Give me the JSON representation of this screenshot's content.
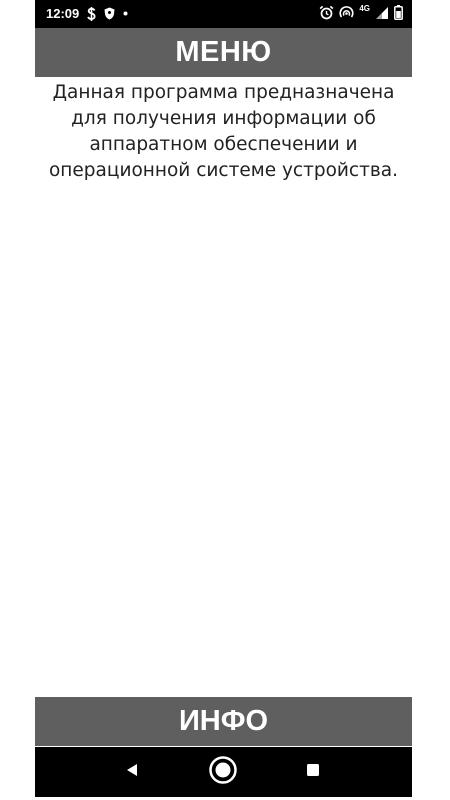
{
  "status_bar": {
    "time": "12:09",
    "icons": [
      "dollar-icon",
      "shield-icon",
      "dot-icon",
      "alarm-icon",
      "hotspot-icon",
      "signal-4g-icon",
      "battery-icon"
    ],
    "network_label": "4G"
  },
  "header": {
    "title": "МЕНЮ"
  },
  "main": {
    "description": "Данная программа предназначена для получения информации об аппаратном обеспечении и операционной системе устройства."
  },
  "footer": {
    "info_button_label": "ИНФО"
  },
  "nav_bar": {
    "buttons": [
      "back-icon",
      "home-icon",
      "recents-icon"
    ]
  },
  "colors": {
    "header_bg": "#5f5f5f",
    "status_bar_bg": "#000000",
    "nav_bar_bg": "#000000",
    "text": "#222222"
  }
}
